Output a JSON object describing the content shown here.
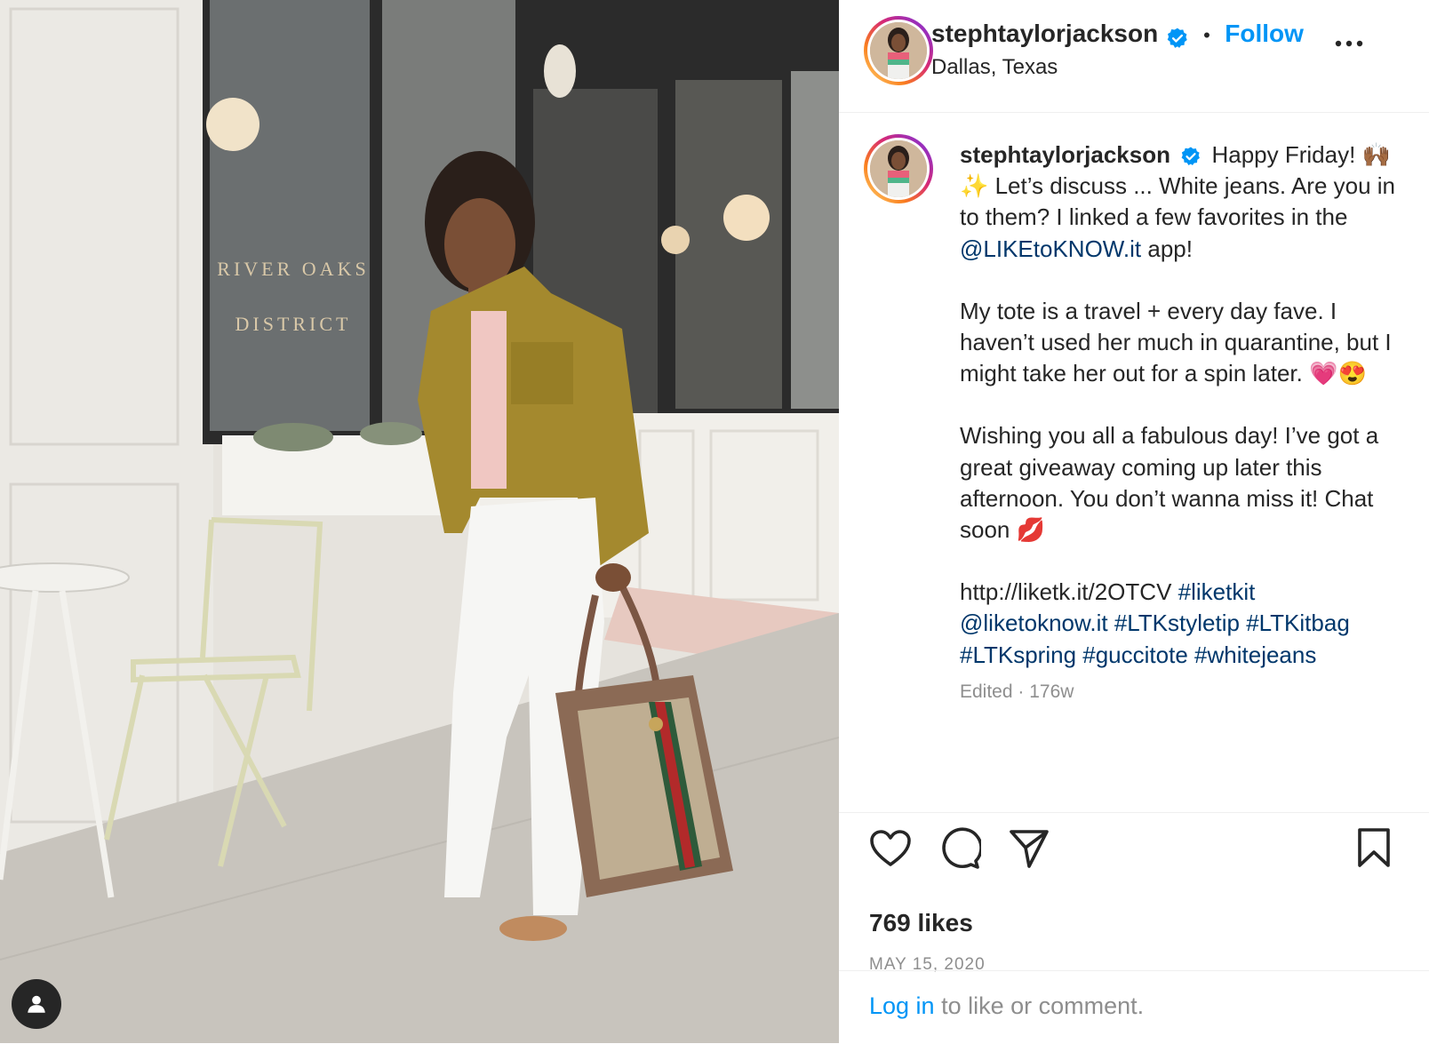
{
  "photo": {
    "sign_line1": "RIVER OAKS",
    "sign_line2": "DISTRICT",
    "tag_icon": "person-icon"
  },
  "header": {
    "username": "stephtaylorjackson",
    "separator": "•",
    "follow_label": "Follow",
    "location": "Dallas, Texas",
    "more_icon": "more-icon",
    "verified_icon": "verified-badge-icon"
  },
  "caption": {
    "username": "stephtaylorjackson",
    "intro": "Happy Friday! 🙌🏾✨ Let’s discuss ... White jeans. Are you in to them? I linked a few favorites in the",
    "mention_app": "@LIKEtoKNOW.it",
    "intro_tail": "app!",
    "para2": "My tote is a travel + every day fave. I haven’t used her much in quarantine, but I might take her out for a spin later. 💗😍",
    "para3": "Wishing you all a fabulous day! I’ve got a great giveaway coming up later this afternoon. You don’t wanna miss it! Chat soon 💋",
    "url": "http://liketk.it/2OTCV",
    "tag1": "#liketkit",
    "mention2": "@liketoknow.it",
    "tag2": "#LTKstyletip",
    "tag3": "#LTKitbag",
    "tag4": "#LTKspring",
    "tag5": "#guccitote",
    "tag6": "#whitejeans",
    "edited": "Edited · 176w"
  },
  "actions": {
    "icons": [
      "heart-icon",
      "comment-icon",
      "share-icon",
      "bookmark-icon"
    ],
    "likes": "769 likes",
    "date": "MAY 15, 2020"
  },
  "login": {
    "link": "Log in",
    "rest": " to like or comment."
  },
  "colors": {
    "accent": "#0095f6",
    "link": "#00376b",
    "text": "#262626",
    "muted": "#8e8e8e"
  }
}
